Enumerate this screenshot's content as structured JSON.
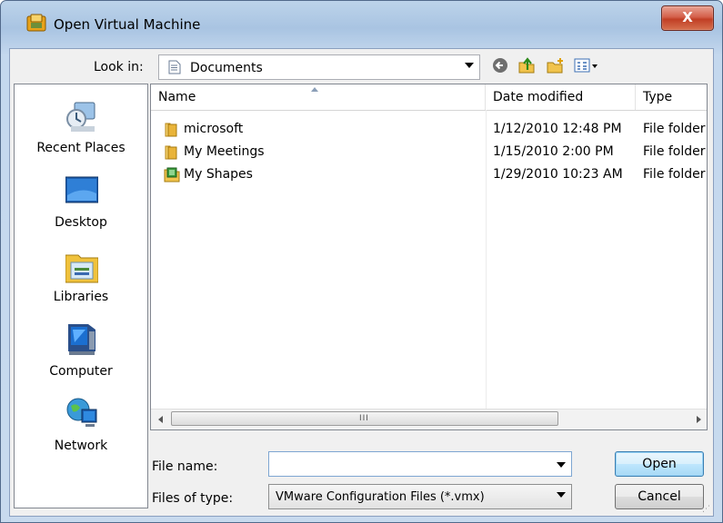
{
  "window": {
    "title": "Open Virtual Machine",
    "close_label": "X"
  },
  "lookin": {
    "label": "Look in:",
    "value": "Documents"
  },
  "toolbar": {
    "icons": [
      "back-icon",
      "up-folder-icon",
      "new-folder-icon",
      "views-menu-icon"
    ]
  },
  "places": [
    {
      "label": "Recent Places",
      "icon": "recent-places-icon"
    },
    {
      "label": "Desktop",
      "icon": "desktop-icon"
    },
    {
      "label": "Libraries",
      "icon": "libraries-icon"
    },
    {
      "label": "Computer",
      "icon": "computer-icon"
    },
    {
      "label": "Network",
      "icon": "network-icon"
    }
  ],
  "columns": {
    "name": "Name",
    "date": "Date modified",
    "type": "Type"
  },
  "files": [
    {
      "name": "microsoft",
      "date": "1/12/2010 12:48 PM",
      "type": "File folder",
      "icon": "folder-icon"
    },
    {
      "name": "My Meetings",
      "date": "1/15/2010 2:00 PM",
      "type": "File folder",
      "icon": "folder-icon"
    },
    {
      "name": "My Shapes",
      "date": "1/29/2010 10:23 AM",
      "type": "File folder",
      "icon": "shapes-folder-icon"
    }
  ],
  "scrollbar": {
    "grip": "III"
  },
  "filename": {
    "label": "File name:",
    "value": ""
  },
  "filetype": {
    "label": "Files of type:",
    "value": "VMware Configuration Files (*.vmx)"
  },
  "buttons": {
    "open": "Open",
    "cancel": "Cancel"
  },
  "colors": {
    "title_bar": "#a9c4e2",
    "close_button": "#c13f25",
    "open_button": "#bee6fd"
  }
}
